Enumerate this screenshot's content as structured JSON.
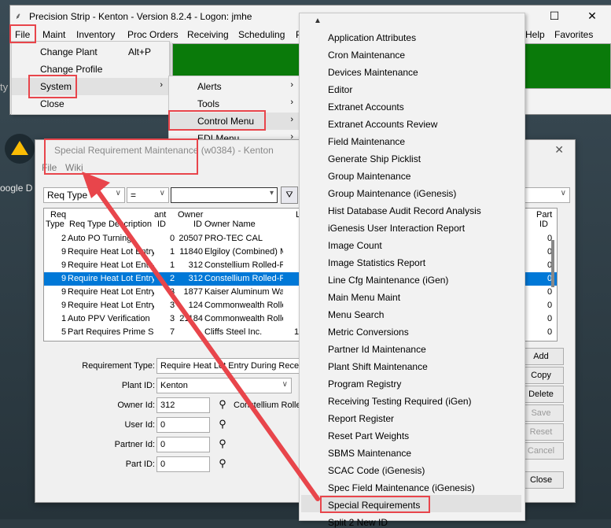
{
  "desktop": {
    "left_text": "oogle D",
    "ty_text": "ty"
  },
  "window": {
    "title": "Precision Strip - Kenton - Version 8.2.4 - Logon: jmhe",
    "menus": [
      "File",
      "Maint",
      "Inventory",
      "Proc Orders",
      "Receiving",
      "Scheduling",
      "P",
      "Help",
      "Favorites"
    ]
  },
  "file_menu": {
    "items": [
      {
        "label": "Change Plant",
        "shortcut": "Alt+P"
      },
      {
        "label": "Change Profile",
        "shortcut": ""
      },
      {
        "label": "System",
        "shortcut": ""
      },
      {
        "label": "Close",
        "shortcut": ""
      }
    ]
  },
  "system_menu": {
    "items": [
      "Alerts",
      "Tools",
      "Control Menu",
      "EDI Menu"
    ]
  },
  "control_menu": {
    "items": [
      "Application Attributes",
      "Cron Maintenance",
      "Devices Maintenance",
      "Editor",
      "Extranet Accounts",
      "Extranet Accounts Review",
      "Field Maintenance",
      "Generate Ship Picklist",
      "Group Maintenance",
      "Group Maintenance (iGenesis)",
      "Hist Database Audit Record Analysis",
      "iGenesis User Interaction Report",
      "Image Count",
      "Image Statistics Report",
      "Line Cfg Maintenance (iGen)",
      "Main Menu Maint",
      "Menu Search",
      "Metric Conversions",
      "Partner Id Maintenance",
      "Plant Shift Maintenance",
      "Program Registry",
      "Receiving Testing Required (iGen)",
      "Report Register",
      "Reset Part Weights",
      "SBMS Maintenance",
      "SCAC Code (iGenesis)",
      "Spec Field Maintenance (iGenesis)",
      "Special Requirements",
      "Split 2 New ID"
    ]
  },
  "dialog": {
    "title": "Special Requirement Maintenance (w0384) - Kenton",
    "menus": [
      "File",
      "Wiki"
    ],
    "filter": {
      "field": "Req Type",
      "op": "=",
      "value": ""
    },
    "grid": {
      "headers": {
        "req_type": [
          "Req",
          "Type"
        ],
        "desc": [
          "Req Type Description"
        ],
        "plant": [
          "ant",
          "ID"
        ],
        "owner_id": [
          "Owner",
          "ID"
        ],
        "owner_name": [
          "Owner Name"
        ],
        "l": [
          "L"
        ],
        "part_id": [
          "Part",
          "ID"
        ]
      },
      "rows": [
        {
          "type": "2",
          "desc": "Auto PO Turning",
          "plant": "0",
          "owner": "20507",
          "name": "PRO-TEC CAL",
          "l": "",
          "part": "0",
          "selected": false
        },
        {
          "type": "9",
          "desc": "Require Heat Lot Entry",
          "plant": "1",
          "owner": "11840",
          "name": "Elgiloy (Combined) M",
          "l": "",
          "part": "0",
          "selected": false
        },
        {
          "type": "9",
          "desc": "Require Heat Lot Entry",
          "plant": "1",
          "owner": "312",
          "name": "Constellium  Rolled-R",
          "l": "",
          "part": "0",
          "selected": false
        },
        {
          "type": "9",
          "desc": "Require Heat Lot Entry",
          "plant": "2",
          "owner": "312",
          "name": "Constellium  Rolled-R",
          "l": "",
          "part": "0",
          "selected": true
        },
        {
          "type": "9",
          "desc": "Require Heat Lot Entry",
          "plant": "3",
          "owner": "1877",
          "name": "Kaiser Aluminum Wa",
          "l": "",
          "part": "0",
          "selected": false
        },
        {
          "type": "9",
          "desc": "Require Heat Lot Entry",
          "plant": "3",
          "owner": "124",
          "name": "Commonwealth Rolle",
          "l": "",
          "part": "0",
          "selected": false
        },
        {
          "type": "1",
          "desc": "Auto PPV Verification",
          "plant": "3",
          "owner": "21184",
          "name": "Commonwealth Rolle",
          "l": "",
          "part": "0",
          "selected": false
        },
        {
          "type": "5",
          "desc": "Part Requires Prime Si",
          "plant": "7",
          "owner": "",
          "name": "Cliffs Steel Inc.",
          "l": "1",
          "part": "0",
          "selected": false
        }
      ]
    },
    "form": {
      "req_type_label": "Requirement Type:",
      "req_type_value": "Require Heat Lot Entry During Receip",
      "plant_label": "Plant ID:",
      "plant_value": "Kenton",
      "owner_label": "Owner Id:",
      "owner_value": "312",
      "owner_name": "Constellium  Rolle",
      "user_label": "User Id:",
      "user_value": "0",
      "partner_label": "Partner Id:",
      "partner_value": "0",
      "part_label": "Part ID:",
      "part_value": "0"
    },
    "buttons": [
      "Add",
      "Copy",
      "Delete",
      "Save",
      "Reset",
      "Cancel",
      "Close"
    ]
  },
  "colors": {
    "highlight_red": "#e8454b",
    "selection_blue": "#0078d7",
    "green_panel": "#0a7a0a"
  },
  "icons": [
    "precision-strip-app-icon",
    "minimize-icon",
    "maximize-icon",
    "close-icon",
    "google-drive-icon",
    "binoculars-icon",
    "filter-icon",
    "chevron-right-icon",
    "chevron-down-icon",
    "scroll-up-icon"
  ]
}
